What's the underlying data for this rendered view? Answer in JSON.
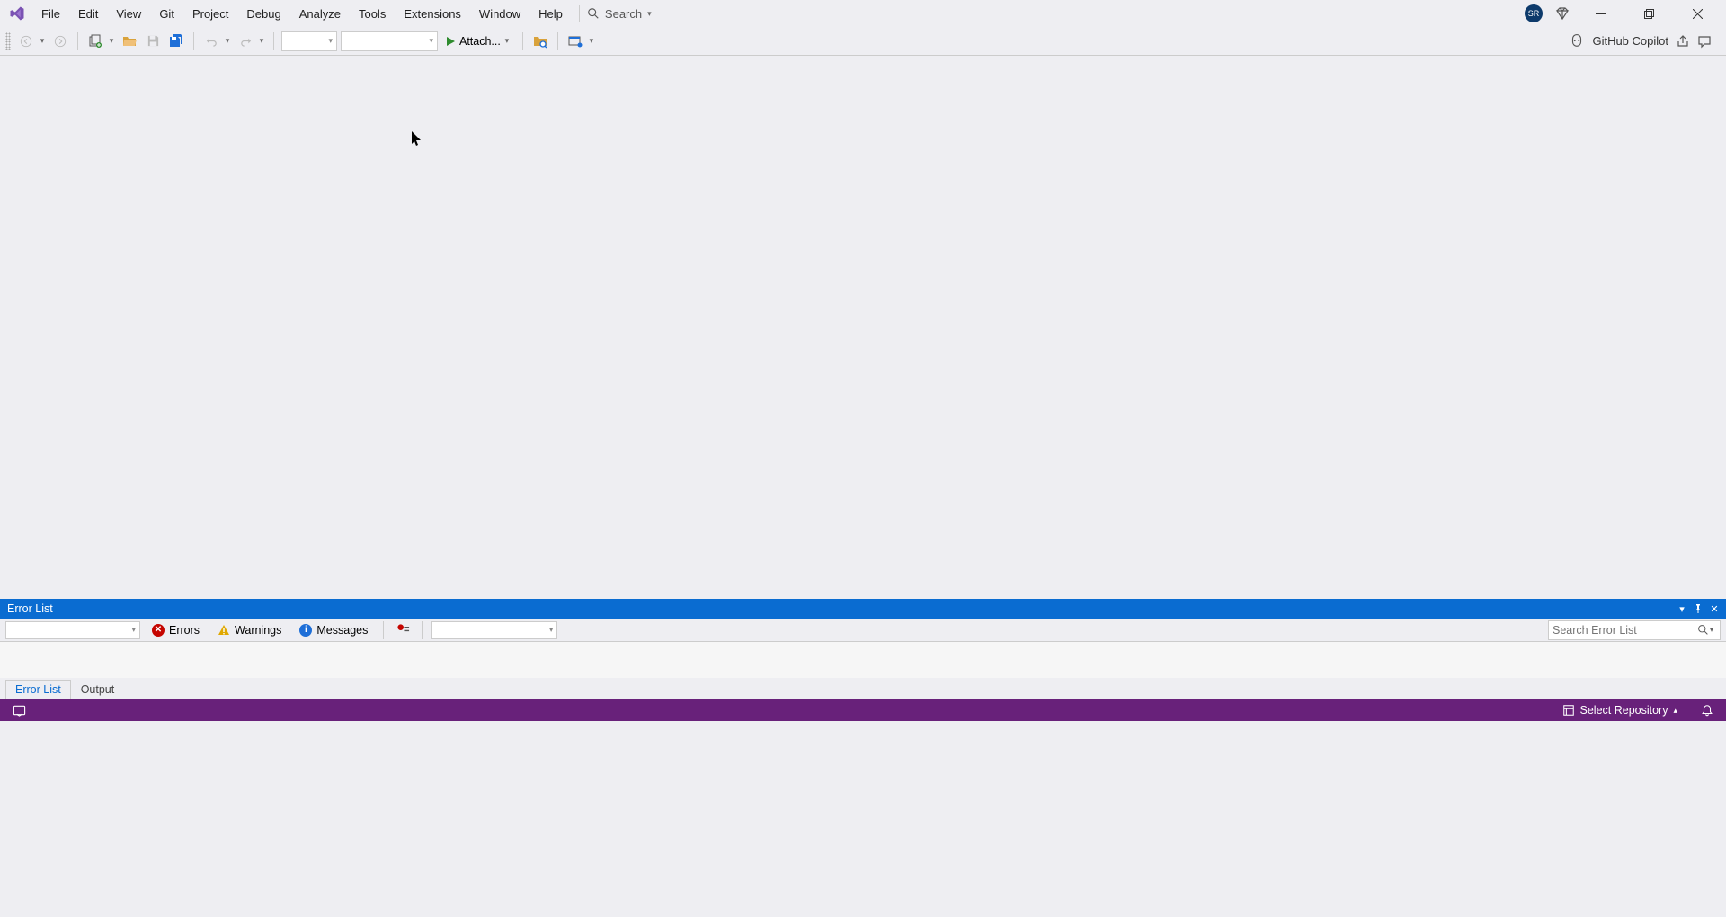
{
  "menubar": {
    "items": [
      "File",
      "Edit",
      "View",
      "Git",
      "Project",
      "Debug",
      "Analyze",
      "Tools",
      "Extensions",
      "Window",
      "Help"
    ],
    "search_label": "Search"
  },
  "titlebar": {
    "avatar_initials": "SR"
  },
  "toolbar": {
    "start_label": "Attach...",
    "copilot_label": "GitHub Copilot"
  },
  "error_panel": {
    "title": "Error List",
    "filters": {
      "errors": "Errors",
      "warnings": "Warnings",
      "messages": "Messages"
    },
    "search_placeholder": "Search Error List"
  },
  "bottom_tabs": {
    "error_list": "Error List",
    "output": "Output"
  },
  "statusbar": {
    "select_repo": "Select Repository"
  }
}
